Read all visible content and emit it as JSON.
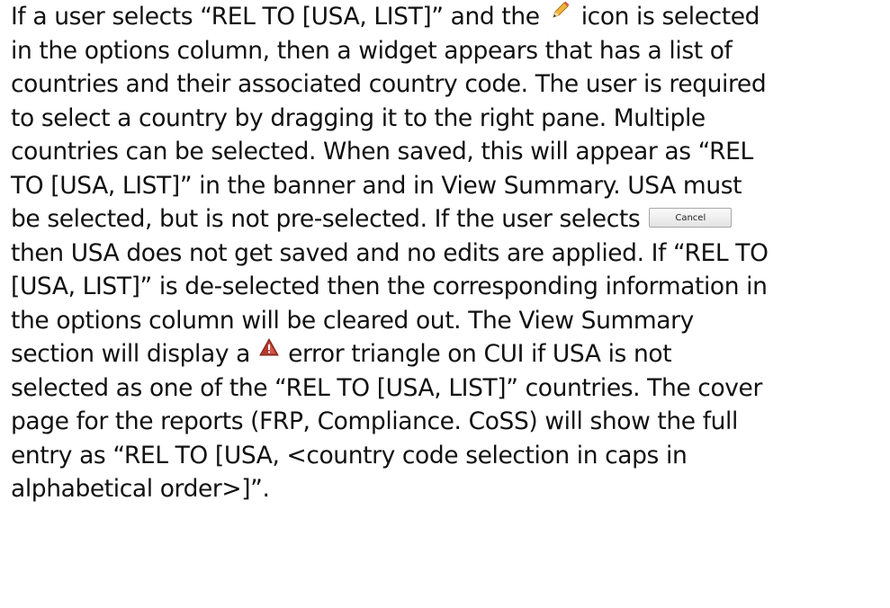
{
  "paragraph": {
    "l1a": "If a user selects “REL TO [USA, LIST]” and the",
    "l1b": "icon is selected",
    "l2": "in the options column, then a widget appears that has a list of",
    "l3": "countries and their associated country code.  The user is required",
    "l4": "to select a country by dragging it to the right pane. Multiple",
    "l5": "countries can be selected. When saved, this will appear as “REL",
    "l6": "TO [USA, LIST]” in the banner and in View Summary. USA must",
    "l7": "be selected, but is not pre-selected. If the user selects",
    "l8": "then USA does not get saved and no edits are applied.  If “REL TO",
    "l9": "[USA, LIST]” is de-selected then the corresponding information in",
    "l10": "the options column will be cleared out. The View Summary",
    "l11a": "section will display a",
    "l11b": "error triangle on CUI if USA is not",
    "l12": "selected as one of the “REL TO [USA, LIST]” countries. The cover",
    "l13": "page for the reports (FRP, Compliance. CoSS) will show the full",
    "l14": "entry as “REL TO [USA, <country code selection in caps in",
    "l15": "alphabetical order>]”."
  },
  "inline_button": {
    "label": "Cancel"
  },
  "icons": {
    "edit": "pencil-icon",
    "error": "error-triangle-icon"
  },
  "colors": {
    "text": "#111111",
    "pencil_body": "#f0b43c",
    "triangle": "#b23a2e"
  }
}
